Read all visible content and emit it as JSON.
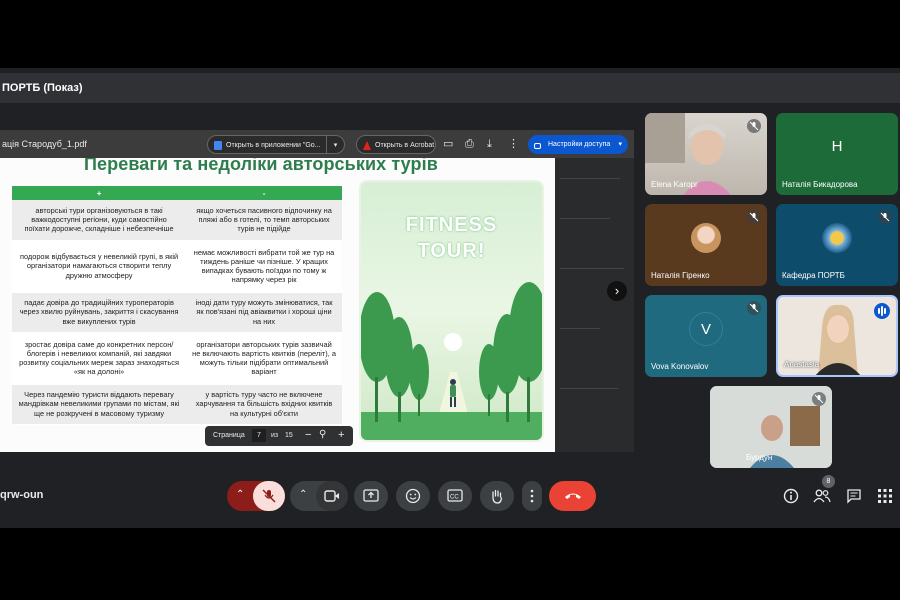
{
  "window": {
    "title": "ПОРТБ (Показ)"
  },
  "pdf": {
    "filename": "ація Стародуб_1.pdf",
    "open_in_app": "Открыть в приложении \"Go...",
    "open_acrobat": "Открыть в Acrobat",
    "access": "Настройки доступа",
    "page_label": "Страница",
    "page_current": "7",
    "page_sep": "из",
    "page_total": "15"
  },
  "slide": {
    "title": "Переваги та недоліки авторських турів",
    "plus_header": "+",
    "minus_header": "-",
    "rows": [
      {
        "plus": "авторські тури організовуються в такі важкодоступні регіони, куди самостійно поїхати дорожче, складніше і небезпечніше",
        "minus": "якщо хочеться пасивного відпочинку на пляжі або в готелі, то темп авторських турів не підійде"
      },
      {
        "plus": "подорож відбувається у невеликій групі, в якій організатори намагаються створити теплу дружню атмосферу",
        "minus": "немає можливості вибрати той же тур на тиждень раніше чи пізніше. У кращих випадках бувають поїздки по тому ж напрямку через рік"
      },
      {
        "plus": "падає довіра до традиційних туроператорів через хвилю руйнувань, закриття і скасування вже викуплених турів",
        "minus": "іноді дати туру можуть змінюватися, так як пов'язані під авіаквитки і хороші ціни на них"
      },
      {
        "plus": "зростає довіра саме до конкретних персон/блогерів і невеликих компаній, які завдяки розвитку соціальних мереж зараз знаходяться «як на долоні»",
        "minus": "організатори авторських турів зазвичай не включають вартість квитків (переліт), а можуть тільки підібрати оптимальний варіант"
      },
      {
        "plus": "Через пандемію туристи віддають перевагу мандрівкам невеликими групами по містам, які ще не розкручені в масовому туризму",
        "minus": "у вартість туру часто не включене харчування та більшість вхідних квитків на культурні об'єкти"
      }
    ],
    "poster_line1": "FITNESS",
    "poster_line2": "TOUR!"
  },
  "participants": [
    {
      "name": "Elena Karopr",
      "type": "video",
      "muted": true
    },
    {
      "name": "Наталія Бикадорова",
      "initial": "H",
      "type": "avatar",
      "muted": false
    },
    {
      "name": "Наталія Гіренко",
      "type": "photo",
      "muted": true
    },
    {
      "name": "Кафедра ПОРТБ",
      "type": "logo",
      "muted": true
    },
    {
      "name": "Vova Konovalov",
      "initial": "V",
      "type": "avatar",
      "muted": true
    },
    {
      "name": "Anastasia",
      "type": "video",
      "speaking": true
    },
    {
      "name": "Бурдун",
      "type": "video",
      "muted": true
    }
  ],
  "meeting": {
    "code": "qrw-oun",
    "participant_count": "8"
  },
  "colors": {
    "accent": "#0b57d0",
    "end_call": "#ea4335",
    "green": "#34a853"
  }
}
